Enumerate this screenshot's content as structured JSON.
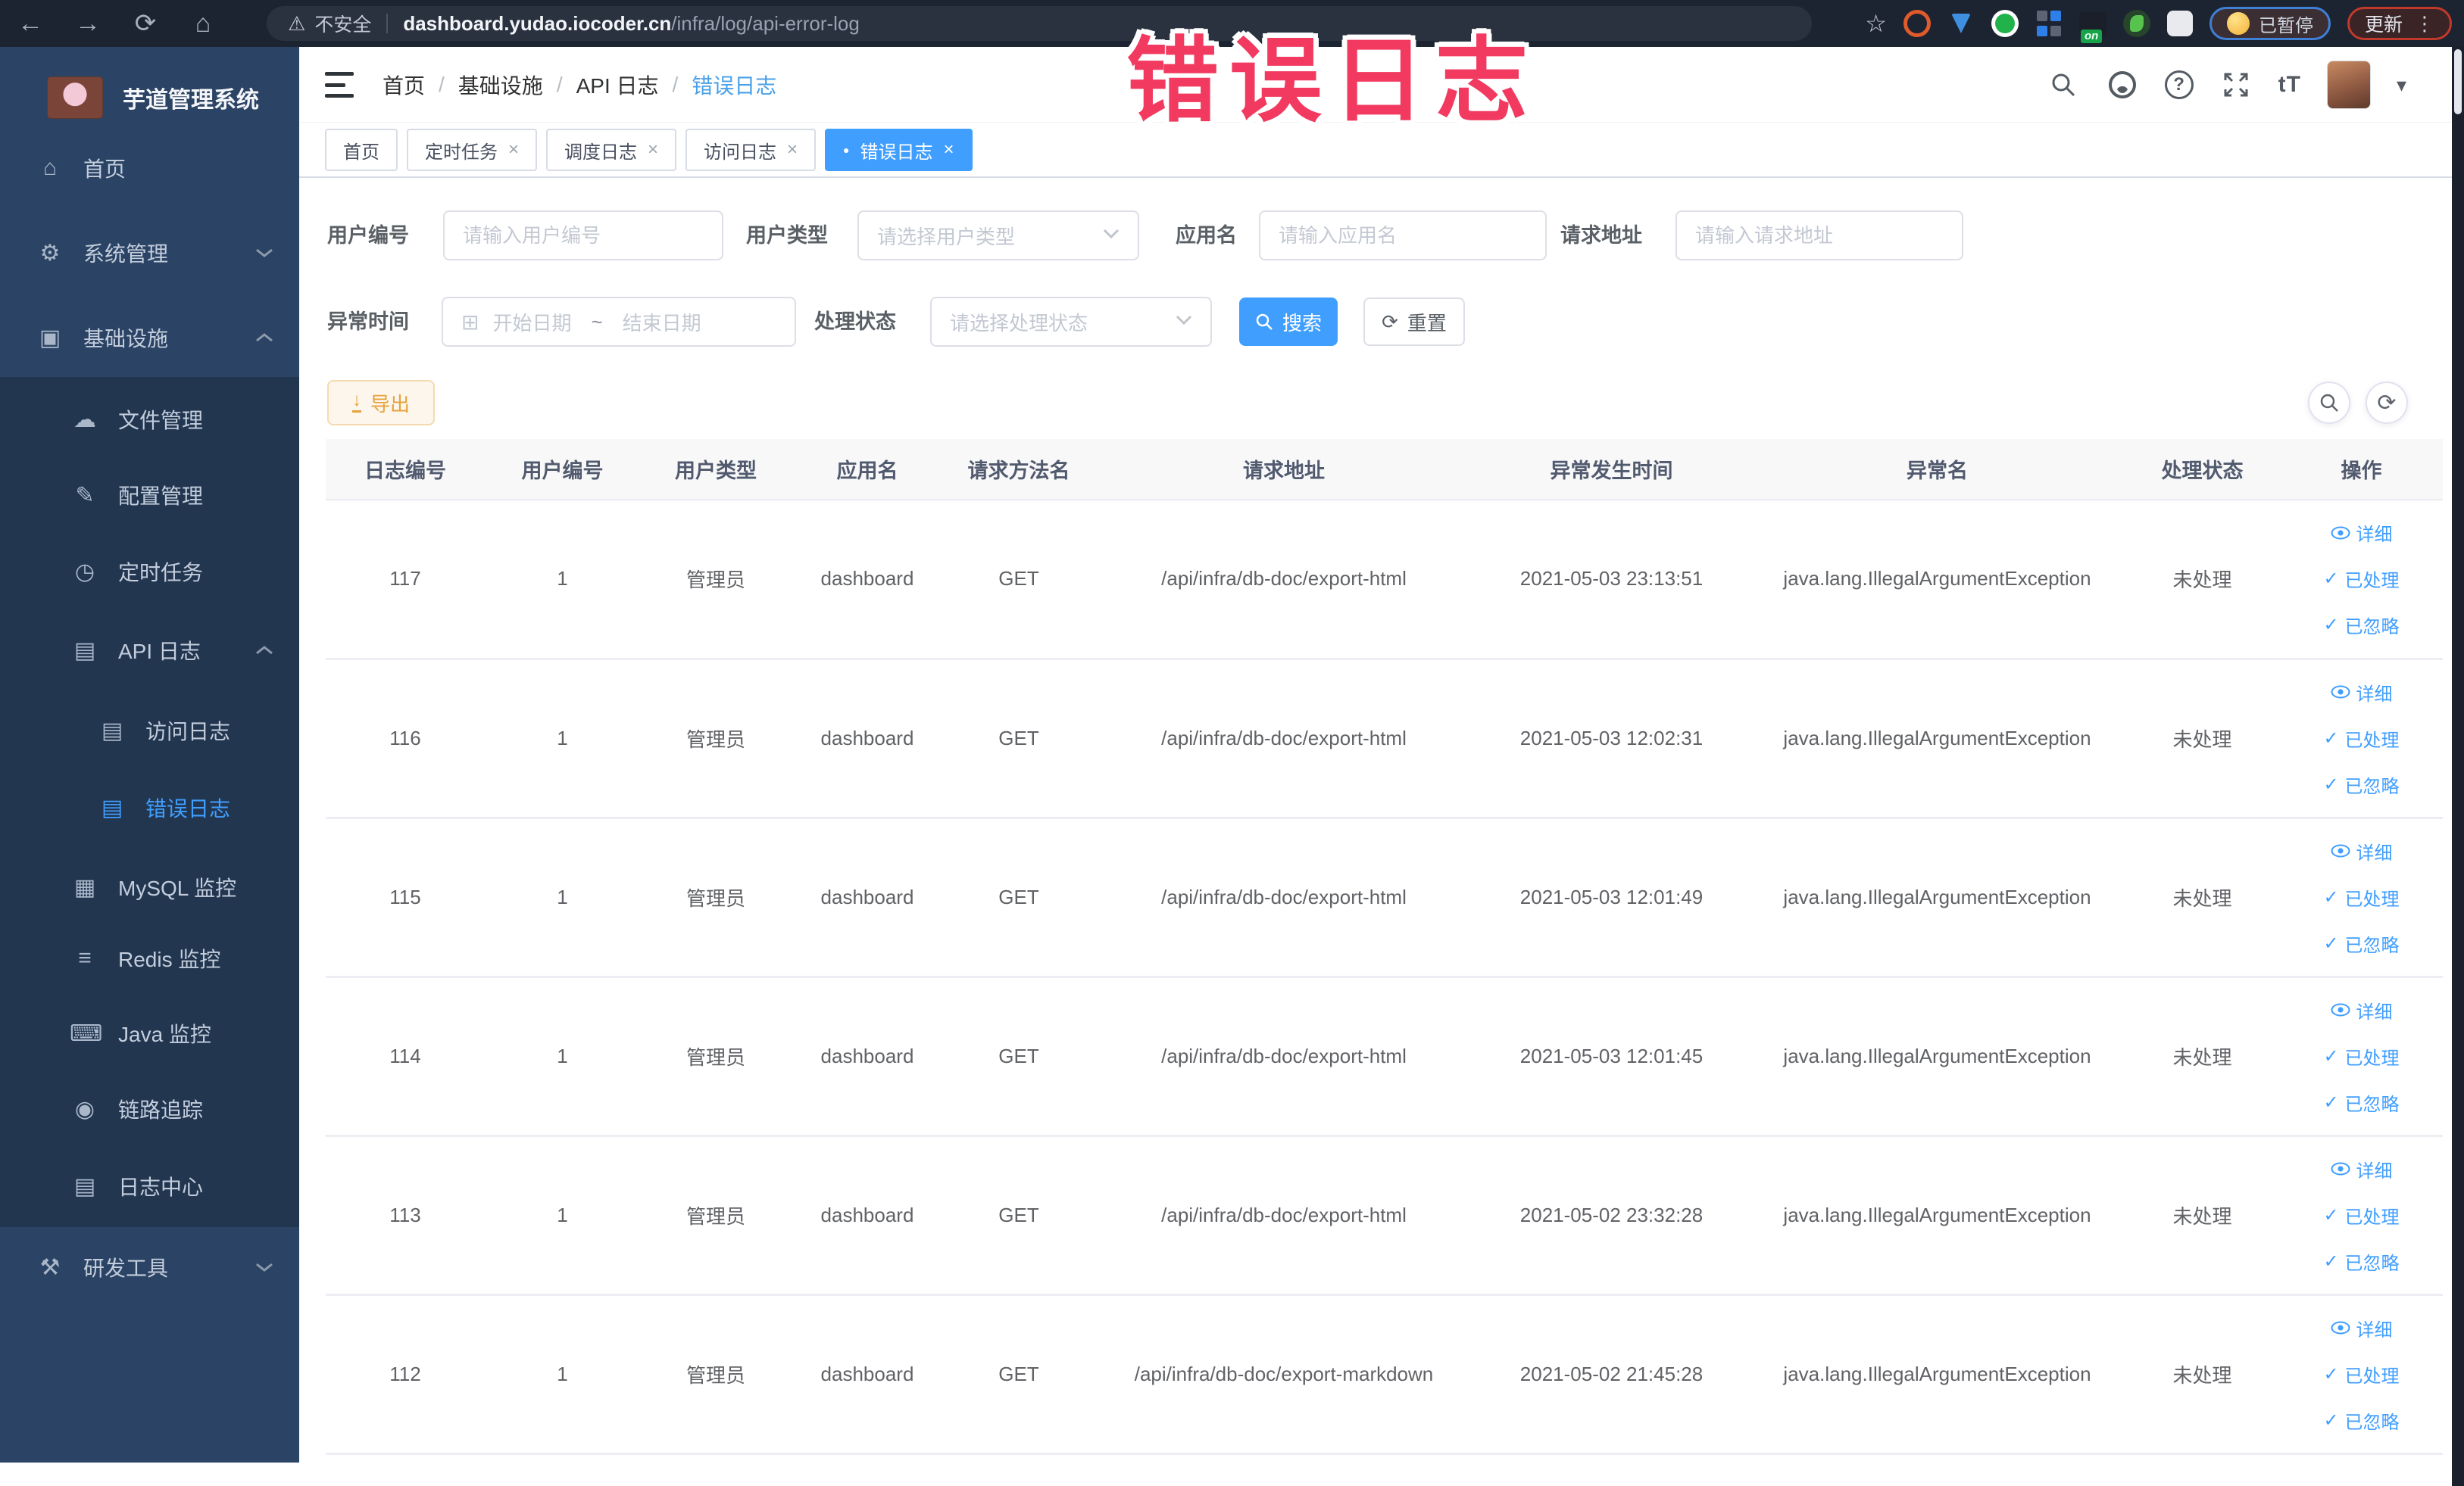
{
  "watermark": "错误日志",
  "browser": {
    "security_label": "不安全",
    "url_domain": "dashboard.yudao.iocoder.cn",
    "url_path": "/infra/log/api-error-log",
    "extension_on_badge": "on",
    "profile_chip": "已暂停",
    "update_button": "更新"
  },
  "icons": {
    "back": "←",
    "forward": "→",
    "reload": "⟳",
    "home": "⌂",
    "warning": "⚠",
    "bookmark": "☆",
    "menu_home": "⌂",
    "menu_gear": "⚙",
    "menu_infra": "▣",
    "menu_file": "☁",
    "menu_config": "✎",
    "menu_job": "◷",
    "menu_apilog": "▤",
    "menu_doc": "▤",
    "menu_mysql": "▦",
    "menu_redis": "≡",
    "menu_java": "⌨",
    "menu_trace": "◉",
    "menu_logcenter": "▤",
    "menu_tools": "⚒",
    "calendar": "⊞",
    "refresh": "⟳",
    "download": "↓",
    "question": "?",
    "fontsize": "tT",
    "caret": "▾",
    "dots": "⋮",
    "check": "✓",
    "dot": "●",
    "close": "×"
  },
  "sidebar": {
    "app_title": "芋道管理系统",
    "items": [
      {
        "label": "首页"
      },
      {
        "label": "系统管理"
      },
      {
        "label": "基础设施"
      },
      {
        "label": "文件管理"
      },
      {
        "label": "配置管理"
      },
      {
        "label": "定时任务"
      },
      {
        "label": "API 日志"
      },
      {
        "label": "访问日志"
      },
      {
        "label": "错误日志"
      },
      {
        "label": "MySQL 监控"
      },
      {
        "label": "Redis 监控"
      },
      {
        "label": "Java 监控"
      },
      {
        "label": "链路追踪"
      },
      {
        "label": "日志中心"
      },
      {
        "label": "研发工具"
      }
    ]
  },
  "breadcrumb": {
    "separator": "/",
    "items": [
      "首页",
      "基础设施",
      "API 日志",
      "错误日志"
    ]
  },
  "tabs": [
    {
      "label": "首页"
    },
    {
      "label": "定时任务"
    },
    {
      "label": "调度日志"
    },
    {
      "label": "访问日志"
    },
    {
      "label": "错误日志"
    }
  ],
  "filters": {
    "user_id_label": "用户编号",
    "user_id_placeholder": "请输入用户编号",
    "user_type_label": "用户类型",
    "user_type_placeholder": "请选择用户类型",
    "app_name_label": "应用名",
    "app_name_placeholder": "请输入应用名",
    "request_url_label": "请求地址",
    "request_url_placeholder": "请输入请求地址",
    "exception_time_label": "异常时间",
    "date_start_placeholder": "开始日期",
    "date_separator": "~",
    "date_end_placeholder": "结束日期",
    "process_status_label": "处理状态",
    "process_status_placeholder": "请选择处理状态",
    "search_label": "搜索",
    "reset_label": "重置"
  },
  "toolbar": {
    "export_label": "导出"
  },
  "table": {
    "columns": [
      "日志编号",
      "用户编号",
      "用户类型",
      "应用名",
      "请求方法名",
      "请求地址",
      "异常发生时间",
      "异常名",
      "处理状态",
      "操作"
    ],
    "action_labels": [
      "详细",
      "已处理",
      "已忽略"
    ],
    "rows": [
      {
        "id": "117",
        "user_id": "1",
        "user_type": "管理员",
        "app_name": "dashboard",
        "method": "GET",
        "url": "/api/infra/db-doc/export-html",
        "time": "2021-05-03 23:13:51",
        "exception": "java.lang.IllegalArgumentException",
        "status": "未处理"
      },
      {
        "id": "116",
        "user_id": "1",
        "user_type": "管理员",
        "app_name": "dashboard",
        "method": "GET",
        "url": "/api/infra/db-doc/export-html",
        "time": "2021-05-03 12:02:31",
        "exception": "java.lang.IllegalArgumentException",
        "status": "未处理"
      },
      {
        "id": "115",
        "user_id": "1",
        "user_type": "管理员",
        "app_name": "dashboard",
        "method": "GET",
        "url": "/api/infra/db-doc/export-html",
        "time": "2021-05-03 12:01:49",
        "exception": "java.lang.IllegalArgumentException",
        "status": "未处理"
      },
      {
        "id": "114",
        "user_id": "1",
        "user_type": "管理员",
        "app_name": "dashboard",
        "method": "GET",
        "url": "/api/infra/db-doc/export-html",
        "time": "2021-05-03 12:01:45",
        "exception": "java.lang.IllegalArgumentException",
        "status": "未处理"
      },
      {
        "id": "113",
        "user_id": "1",
        "user_type": "管理员",
        "app_name": "dashboard",
        "method": "GET",
        "url": "/api/infra/db-doc/export-html",
        "time": "2021-05-02 23:32:28",
        "exception": "java.lang.IllegalArgumentException",
        "status": "未处理"
      },
      {
        "id": "112",
        "user_id": "1",
        "user_type": "管理员",
        "app_name": "dashboard",
        "method": "GET",
        "url": "/api/infra/db-doc/export-markdown",
        "time": "2021-05-02 21:45:28",
        "exception": "java.lang.IllegalArgumentException",
        "status": "未处理"
      }
    ]
  }
}
